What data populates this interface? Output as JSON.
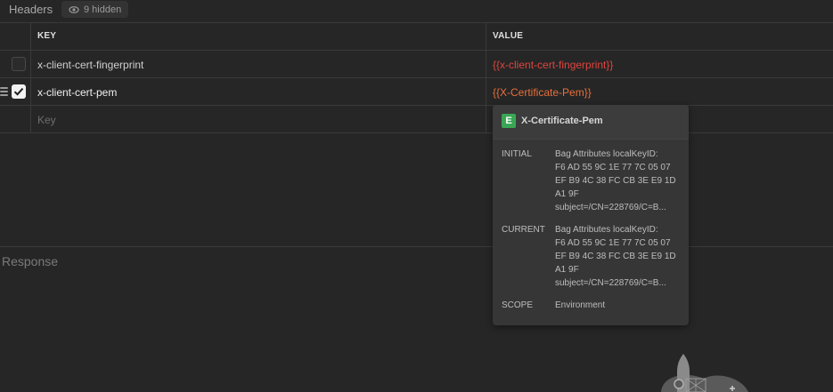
{
  "section": {
    "title": "Headers",
    "hidden_label": "9 hidden"
  },
  "table": {
    "columns": {
      "key": "KEY",
      "value": "VALUE"
    },
    "rows": [
      {
        "key": "x-client-cert-fingerprint",
        "value": "{{x-client-cert-fingerprint}}",
        "enabled": false,
        "value_color": "#e0443e"
      },
      {
        "key": "x-client-cert-pem",
        "value": "{{X-Certificate-Pem}}",
        "enabled": true,
        "value_color": "#e8703a"
      }
    ],
    "new_row_placeholder": "Key"
  },
  "response": {
    "label": "Response"
  },
  "tooltip": {
    "badge": "E",
    "name": "X-Certificate-Pem",
    "initial_label": "INITIAL",
    "initial_value": "Bag Attributes localKeyID:\nF6 AD 55 9C 1E 77 7C 05 07\nEF B9 4C 38 FC CB 3E E9 1D\nA1 9F\nsubject=/CN=228769/C=B...",
    "current_label": "CURRENT",
    "current_value": "Bag Attributes localKeyID:\nF6 AD 55 9C 1E 77 7C 05 07\nEF B9 4C 38 FC CB 3E E9 1D\nA1 9F\nsubject=/CN=228769/C=B...",
    "scope_label": "SCOPE",
    "scope_value": "Environment"
  },
  "colors": {
    "background": "#262626",
    "env_badge": "#3aa655",
    "unresolved_var": "#e0443e",
    "resolved_var": "#e8703a"
  }
}
